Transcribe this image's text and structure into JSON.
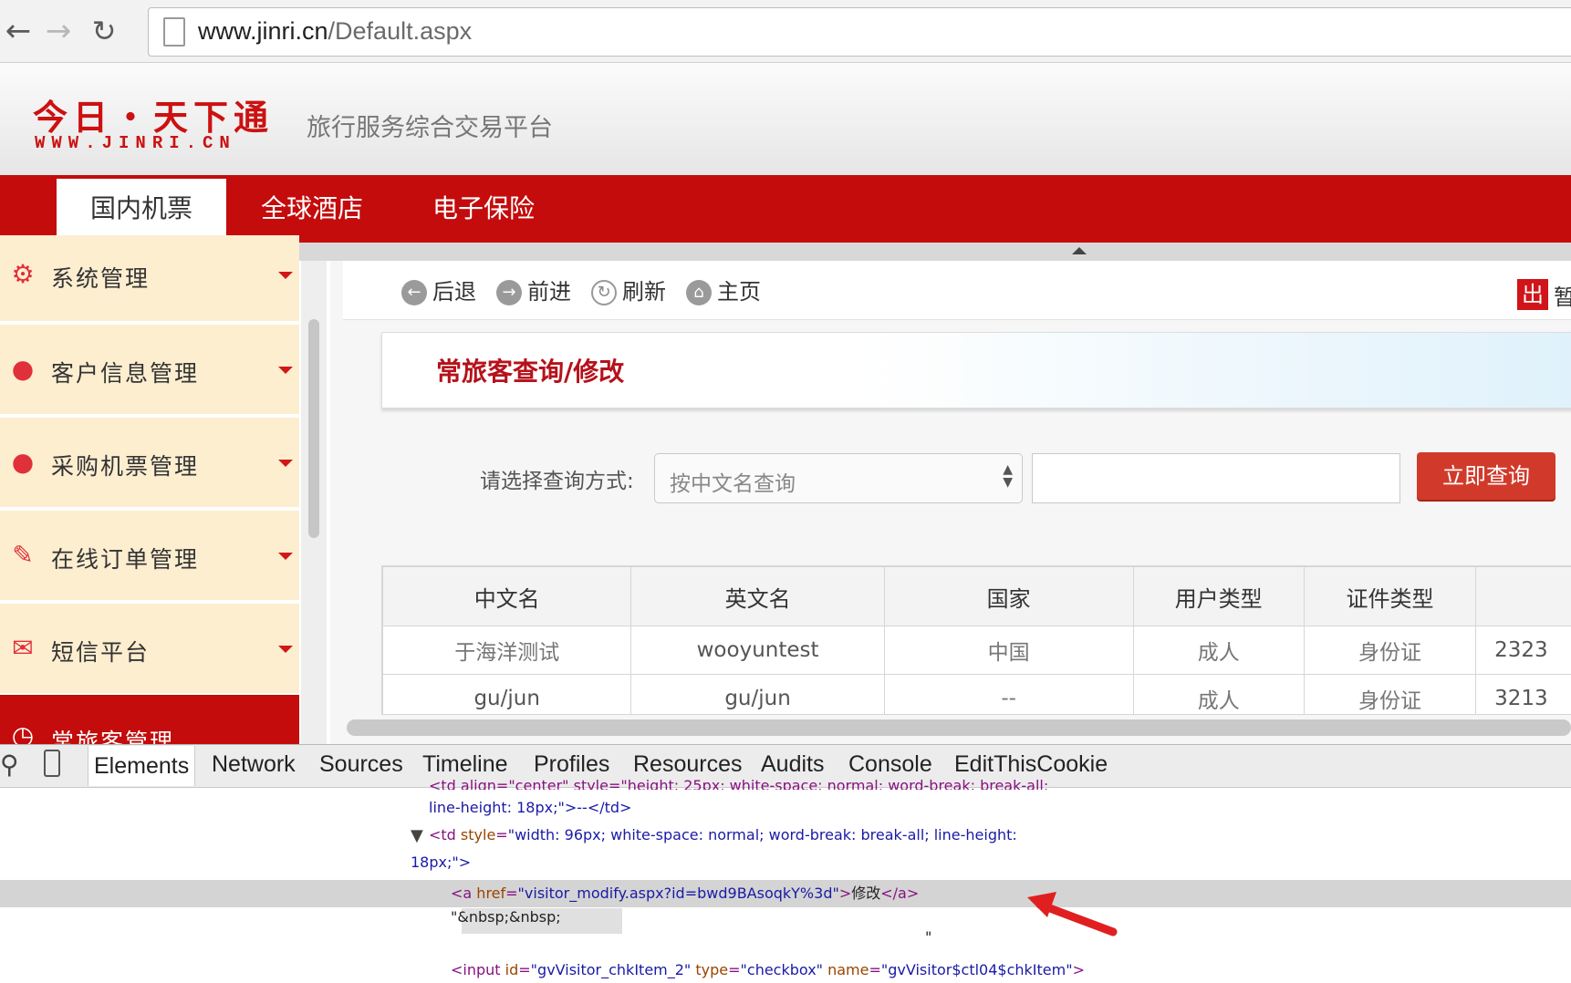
{
  "browser": {
    "url_host": "www.jinri.cn",
    "url_path": "/Default.aspx",
    "back_icon": "arrow-left-icon",
    "forward_icon": "arrow-right-icon",
    "reload_icon": "reload-icon"
  },
  "site": {
    "logo_cn": "今日・天下通",
    "logo_en": "WWW.JINRI.CN",
    "slogan": "旅行服务综合交易平台",
    "nav": [
      "国内机票",
      "全球酒店",
      "电子保险"
    ]
  },
  "sidebar": {
    "items": [
      {
        "label": "系统管理",
        "icon": "gear-icon"
      },
      {
        "label": "客户信息管理",
        "icon": "user-icon"
      },
      {
        "label": "采购机票管理",
        "icon": "chat-bubble-icon"
      },
      {
        "label": "在线订单管理",
        "icon": "pencil-icon"
      },
      {
        "label": "短信平台",
        "icon": "envelope-icon"
      },
      {
        "label": "常旅客管理",
        "icon": "clock-icon"
      }
    ]
  },
  "toolbar": {
    "back": "后退",
    "forward": "前进",
    "refresh": "刷新",
    "home": "主页",
    "exit_icon_text": "出",
    "exit_text": "暂"
  },
  "page": {
    "title": "常旅客查询/修改",
    "query_label": "请选择查询方式:",
    "query_select": "按中文名查询",
    "query_button": "立即查询"
  },
  "table": {
    "headers": [
      "中文名",
      "英文名",
      "国家",
      "用户类型",
      "证件类型",
      ""
    ],
    "rows": [
      [
        "于海洋测试",
        "wooyuntest",
        "中国",
        "成人",
        "身份证",
        "2323"
      ],
      [
        "gu/jun",
        "gu/jun",
        "--",
        "成人",
        "身份证",
        "3213"
      ]
    ]
  },
  "devtools": {
    "tabs": [
      "Elements",
      "Network",
      "Sources",
      "Timeline",
      "Profiles",
      "Resources",
      "Audits",
      "Console",
      "EditThisCookie"
    ],
    "search_icon": "magnifier-icon",
    "device_icon": "mobile-device-icon",
    "code": {
      "line0": "<td align=\"center\" style=\"height: 25px; white-space: normal; word-break: break-all;",
      "line1_text": "line-height: 18px;\">--</td>",
      "line2_tag": "<td ",
      "line2_attr": "style",
      "line2_val": "\"width: 96px; white-space: normal; word-break: break-all; line-height:",
      "line3": "18px;\">",
      "line4_tag": "<a ",
      "line4_attr": "href",
      "line4_val": "\"visitor_modify.aspx?id=bwd9BAsoqkY%3d\"",
      "line4_text": "修改",
      "line4_close": "</a>",
      "line5": "\"&nbsp;&nbsp;",
      "line6": "\"",
      "line7_tag": "<input ",
      "line7_attr1": "id",
      "line7_val1": "\"gvVisitor_chkItem_2\"",
      "line7_attr2": "type",
      "line7_val2": "\"checkbox\"",
      "line7_attr3": "name",
      "line7_val3": "\"gvVisitor$ctl04$chkItem\"",
      "line7_end": ">"
    },
    "annotation_icon": "red-arrow-annotation"
  },
  "colors": {
    "brand_red": "#c40c0c",
    "sidebar_bg": "#fdeed0",
    "title_red": "#b5121b",
    "query_button": "#d13a2a"
  }
}
